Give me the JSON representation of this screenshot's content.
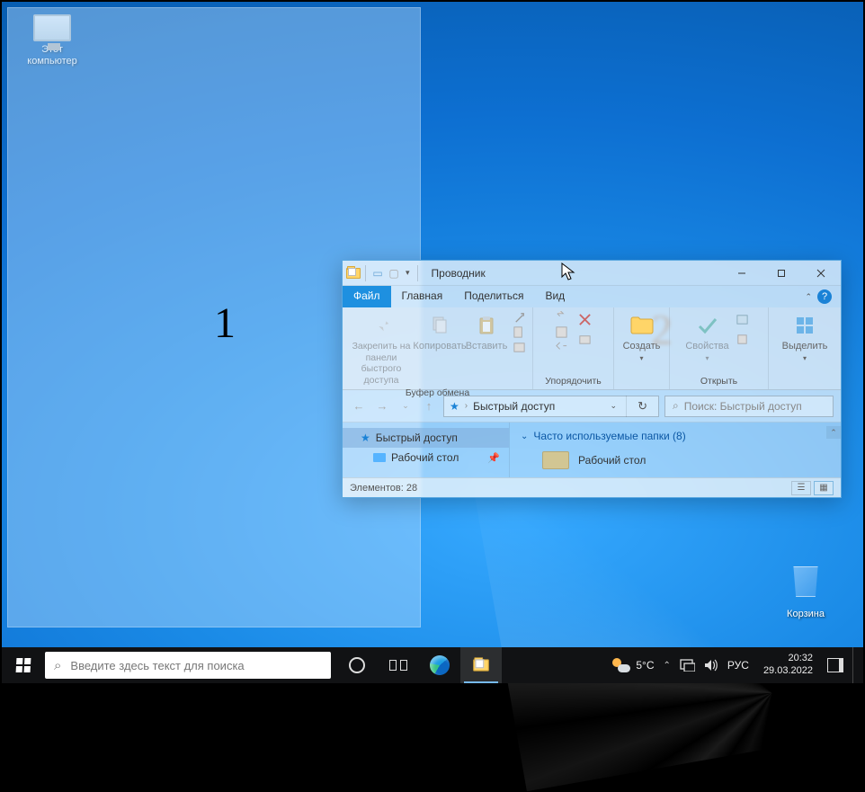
{
  "desktop": {
    "this_pc": "Этот компьютер",
    "recycle_bin": "Корзина"
  },
  "annotations": {
    "one": "1",
    "two": "2"
  },
  "explorer": {
    "title": "Проводник",
    "tabs": {
      "file": "Файл",
      "home": "Главная",
      "share": "Поделиться",
      "view": "Вид"
    },
    "ribbon": {
      "pin": "Закрепить на панели быстрого доступа",
      "copy": "Копировать",
      "paste": "Вставить",
      "clipboard": "Буфер обмена",
      "organize": "Упорядочить",
      "new": "Создать",
      "properties": "Свойства",
      "open": "Открыть",
      "select": "Выделить"
    },
    "address": {
      "quick_access": "Быстрый доступ"
    },
    "search": {
      "placeholder": "Поиск: Быстрый доступ"
    },
    "nav": {
      "quick_access": "Быстрый доступ",
      "desktop": "Рабочий стол"
    },
    "content": {
      "group": "Часто используемые папки (8)",
      "desktop": "Рабочий стол"
    },
    "status": {
      "items_label": "Элементов:",
      "count": "28"
    }
  },
  "taskbar": {
    "search_placeholder": "Введите здесь текст для поиска",
    "weather_temp": "5°C",
    "lang": "РУС",
    "time": "20:32",
    "date": "29.03.2022"
  }
}
